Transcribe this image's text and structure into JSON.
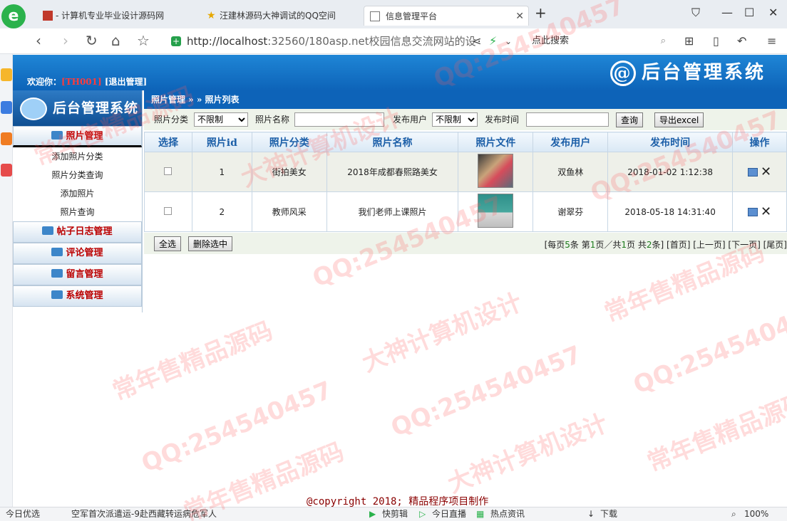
{
  "browser": {
    "tabs": [
      {
        "title": "- 计算机专业毕业设计源码网"
      },
      {
        "title": "汪建林源码大神调试的QQ空间"
      },
      {
        "title": "信息管理平台"
      }
    ],
    "url_host": "http://localhost",
    "url_rest": ":32560/180asp.net校园信息交流网站的设",
    "search_placeholder": "点此搜索",
    "browser_logo": "e",
    "status": {
      "left": "今日优选",
      "news": "空军首次派遣运-9赴西藏转运病危军人",
      "item1": "快剪辑",
      "item2": "今日直播",
      "item3": "热点资讯",
      "download": "下载",
      "zoom": "100%"
    }
  },
  "header": {
    "welcome_prefix": "欢迎你：",
    "username": "[TH001]",
    "logout": "[退出管理]",
    "brand": "后台管理系统",
    "brand_at": "@"
  },
  "sidebar": {
    "brand": "后台管理系统",
    "photo_menu": "照片管理",
    "items": [
      "添加照片分类",
      "照片分类查询",
      "添加照片",
      "照片查询"
    ],
    "other_menus": [
      "帖子日志管理",
      "评论管理",
      "留言管理",
      "系统管理"
    ]
  },
  "breadcrumb": "照片管理 » » 照片列表",
  "filters": {
    "category_label": "照片分类",
    "category_value": "不限制",
    "name_label": "照片名称",
    "user_label": "发布用户",
    "user_value": "不限制",
    "time_label": "发布时间",
    "query_button": "查询",
    "export_button": "导出excel"
  },
  "table": {
    "headers": [
      "选择",
      "照片id",
      "照片分类",
      "照片名称",
      "照片文件",
      "发布用户",
      "发布时间",
      "操作"
    ],
    "rows": [
      {
        "id": "1",
        "category": "街拍美女",
        "name": "2018年成都春熙路美女",
        "user": "双鱼林",
        "time": "2018-01-02 1:12:38"
      },
      {
        "id": "2",
        "category": "教师风采",
        "name": "我们老师上课照片",
        "user": "谢翠芬",
        "time": "2018-05-18 14:31:40"
      }
    ],
    "delete_glyph": "✕"
  },
  "toolbar": {
    "select_all": "全选",
    "delete_selected": "删除选中",
    "pager": {
      "p1": "[每页",
      "per_page": "5",
      "p2": "条 第",
      "current": "1",
      "p3": "页／共",
      "total_pages": "1",
      "p4": "页 共",
      "total": "2",
      "p5": "条]",
      "first": "[首页]",
      "prev": "[上一页]",
      "next": "[下一页]",
      "last": "[尾页]"
    }
  },
  "footer": {
    "copyright": "@copyright 2018; 精品程序项目制作"
  },
  "watermarks": [
    "QQ:254540457",
    "大神计算机设计",
    "常年售精品源码"
  ],
  "colors": {
    "header_blue": "#0d63b8",
    "menu_red": "#bb0000",
    "title_blue": "#1c5fa8"
  }
}
